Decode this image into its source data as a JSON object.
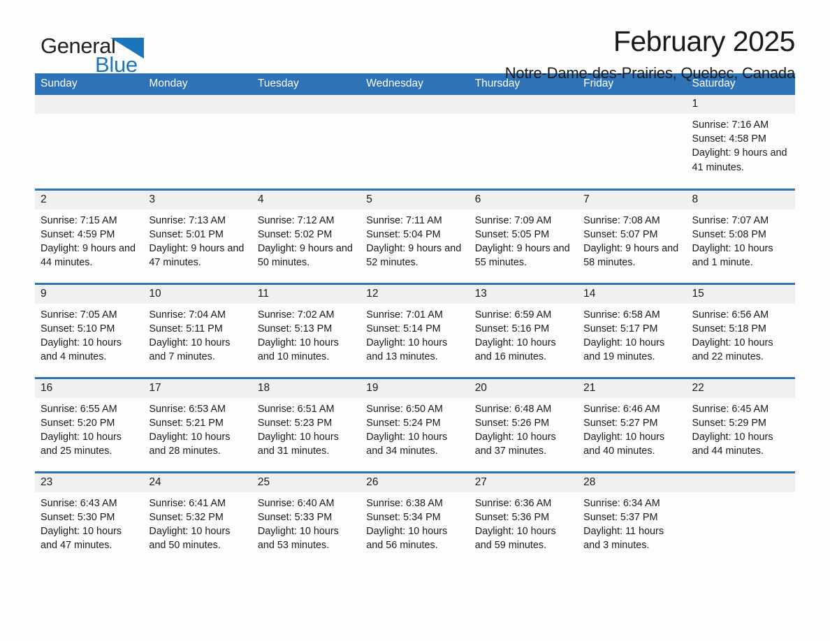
{
  "brand": {
    "name_part1": "General",
    "name_part2": "Blue",
    "accent_color": "#1b75bb",
    "flag_icon": "triangle-flag-icon"
  },
  "header": {
    "title": "February 2025",
    "subtitle": "Notre-Dame-des-Prairies, Quebec, Canada"
  },
  "theme": {
    "header_blue": "#2e72b8",
    "daynum_band": "#f0f0f0",
    "page_bg": "#fdfdfd"
  },
  "weekdays": [
    "Sunday",
    "Monday",
    "Tuesday",
    "Wednesday",
    "Thursday",
    "Friday",
    "Saturday"
  ],
  "weeks": [
    [
      {
        "day": "",
        "info": ""
      },
      {
        "day": "",
        "info": ""
      },
      {
        "day": "",
        "info": ""
      },
      {
        "day": "",
        "info": ""
      },
      {
        "day": "",
        "info": ""
      },
      {
        "day": "",
        "info": ""
      },
      {
        "day": "1",
        "info": "Sunrise: 7:16 AM\nSunset: 4:58 PM\nDaylight: 9 hours and 41 minutes."
      }
    ],
    [
      {
        "day": "2",
        "info": "Sunrise: 7:15 AM\nSunset: 4:59 PM\nDaylight: 9 hours and 44 minutes."
      },
      {
        "day": "3",
        "info": "Sunrise: 7:13 AM\nSunset: 5:01 PM\nDaylight: 9 hours and 47 minutes."
      },
      {
        "day": "4",
        "info": "Sunrise: 7:12 AM\nSunset: 5:02 PM\nDaylight: 9 hours and 50 minutes."
      },
      {
        "day": "5",
        "info": "Sunrise: 7:11 AM\nSunset: 5:04 PM\nDaylight: 9 hours and 52 minutes."
      },
      {
        "day": "6",
        "info": "Sunrise: 7:09 AM\nSunset: 5:05 PM\nDaylight: 9 hours and 55 minutes."
      },
      {
        "day": "7",
        "info": "Sunrise: 7:08 AM\nSunset: 5:07 PM\nDaylight: 9 hours and 58 minutes."
      },
      {
        "day": "8",
        "info": "Sunrise: 7:07 AM\nSunset: 5:08 PM\nDaylight: 10 hours and 1 minute."
      }
    ],
    [
      {
        "day": "9",
        "info": "Sunrise: 7:05 AM\nSunset: 5:10 PM\nDaylight: 10 hours and 4 minutes."
      },
      {
        "day": "10",
        "info": "Sunrise: 7:04 AM\nSunset: 5:11 PM\nDaylight: 10 hours and 7 minutes."
      },
      {
        "day": "11",
        "info": "Sunrise: 7:02 AM\nSunset: 5:13 PM\nDaylight: 10 hours and 10 minutes."
      },
      {
        "day": "12",
        "info": "Sunrise: 7:01 AM\nSunset: 5:14 PM\nDaylight: 10 hours and 13 minutes."
      },
      {
        "day": "13",
        "info": "Sunrise: 6:59 AM\nSunset: 5:16 PM\nDaylight: 10 hours and 16 minutes."
      },
      {
        "day": "14",
        "info": "Sunrise: 6:58 AM\nSunset: 5:17 PM\nDaylight: 10 hours and 19 minutes."
      },
      {
        "day": "15",
        "info": "Sunrise: 6:56 AM\nSunset: 5:18 PM\nDaylight: 10 hours and 22 minutes."
      }
    ],
    [
      {
        "day": "16",
        "info": "Sunrise: 6:55 AM\nSunset: 5:20 PM\nDaylight: 10 hours and 25 minutes."
      },
      {
        "day": "17",
        "info": "Sunrise: 6:53 AM\nSunset: 5:21 PM\nDaylight: 10 hours and 28 minutes."
      },
      {
        "day": "18",
        "info": "Sunrise: 6:51 AM\nSunset: 5:23 PM\nDaylight: 10 hours and 31 minutes."
      },
      {
        "day": "19",
        "info": "Sunrise: 6:50 AM\nSunset: 5:24 PM\nDaylight: 10 hours and 34 minutes."
      },
      {
        "day": "20",
        "info": "Sunrise: 6:48 AM\nSunset: 5:26 PM\nDaylight: 10 hours and 37 minutes."
      },
      {
        "day": "21",
        "info": "Sunrise: 6:46 AM\nSunset: 5:27 PM\nDaylight: 10 hours and 40 minutes."
      },
      {
        "day": "22",
        "info": "Sunrise: 6:45 AM\nSunset: 5:29 PM\nDaylight: 10 hours and 44 minutes."
      }
    ],
    [
      {
        "day": "23",
        "info": "Sunrise: 6:43 AM\nSunset: 5:30 PM\nDaylight: 10 hours and 47 minutes."
      },
      {
        "day": "24",
        "info": "Sunrise: 6:41 AM\nSunset: 5:32 PM\nDaylight: 10 hours and 50 minutes."
      },
      {
        "day": "25",
        "info": "Sunrise: 6:40 AM\nSunset: 5:33 PM\nDaylight: 10 hours and 53 minutes."
      },
      {
        "day": "26",
        "info": "Sunrise: 6:38 AM\nSunset: 5:34 PM\nDaylight: 10 hours and 56 minutes."
      },
      {
        "day": "27",
        "info": "Sunrise: 6:36 AM\nSunset: 5:36 PM\nDaylight: 10 hours and 59 minutes."
      },
      {
        "day": "28",
        "info": "Sunrise: 6:34 AM\nSunset: 5:37 PM\nDaylight: 11 hours and 3 minutes."
      },
      {
        "day": "",
        "info": ""
      }
    ]
  ]
}
